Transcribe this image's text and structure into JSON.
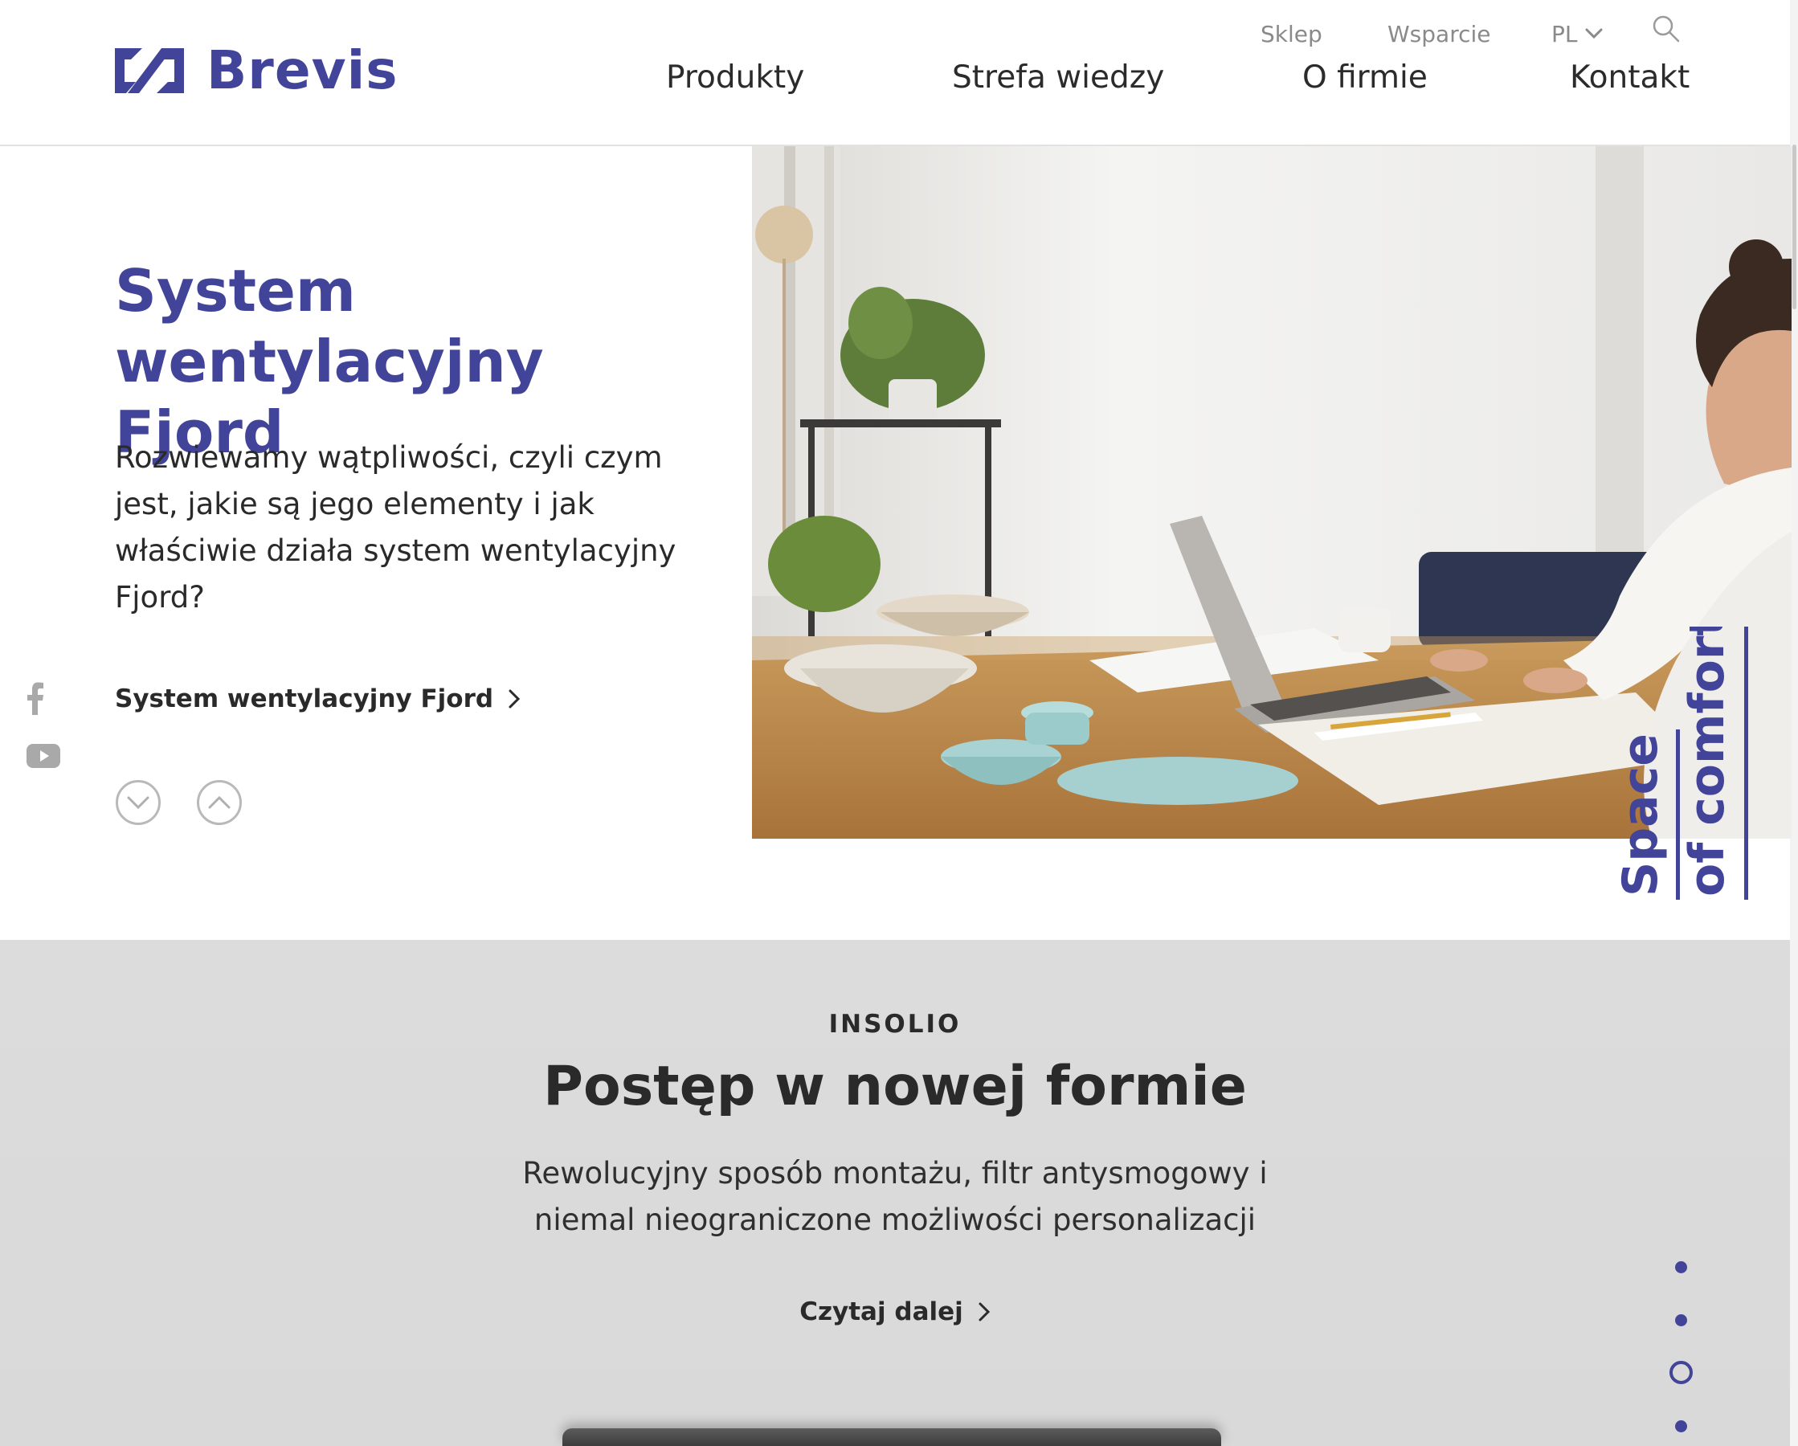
{
  "brand": {
    "name": "Brevis",
    "color": "#42449a"
  },
  "utility_nav": {
    "shop": "Sklep",
    "support": "Wsparcie",
    "language": "PL"
  },
  "main_nav": [
    {
      "label": "Produkty"
    },
    {
      "label": "Strefa wiedzy"
    },
    {
      "label": "O firmie"
    },
    {
      "label": "Kontakt"
    }
  ],
  "hero": {
    "title_line1": "System wentylacyjny",
    "title_line2": "Fjord",
    "text": "Rozwiewamy wątpliwości, czyli czym jest, jakie są jego elementy i jak właściwie działa system wentylacyjny Fjord?",
    "link_label": "System wentylacyjny Fjord",
    "tagline_line1": "Space",
    "tagline_line2": "of comfort"
  },
  "social": [
    "facebook-icon",
    "youtube-icon"
  ],
  "section2": {
    "eyebrow": "INSOLIO",
    "title": "Postęp w nowej formie",
    "text_line1": "Rewolucyjny sposób montażu, filtr antysmogowy i",
    "text_line2": "niemal nieograniczone możliwości personalizacji",
    "link_label": "Czytaj dalej"
  },
  "pagination": {
    "total": 4,
    "active_index": 2
  }
}
